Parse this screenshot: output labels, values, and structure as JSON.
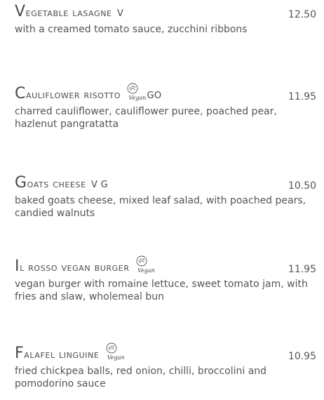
{
  "items": [
    {
      "initial": "V",
      "rest": "egetable lasagne",
      "tags": "V",
      "vegan_logo": false,
      "vegan_logo_text": "",
      "price": "12.50",
      "description": "with a creamed tomato sauce, zucchini ribbons"
    },
    {
      "initial": "C",
      "rest": "auliflower risotto",
      "tags": "Go",
      "vegan_logo": true,
      "vegan_logo_text": "Vegan",
      "price": "11.95",
      "description": "charred cauliflower, cauliflower puree, poached pear, hazlenut pangratatta"
    },
    {
      "initial": "G",
      "rest": "oats cheese",
      "tags": "V G",
      "vegan_logo": false,
      "vegan_logo_text": "",
      "price": "10.50",
      "description": "baked goats cheese, mixed leaf salad, with poached pears, candied walnuts"
    },
    {
      "initial": "I",
      "rest": "l Rosso vegan burger",
      "tags": "",
      "vegan_logo": true,
      "vegan_logo_text": "Vegan",
      "price": "11.95",
      "description": "vegan burger with romaine lettuce, sweet tomato jam, with fries and slaw, wholemeal bun"
    },
    {
      "initial": "F",
      "rest": "alafel linguine",
      "tags": "",
      "vegan_logo": true,
      "vegan_logo_text": "Vegan",
      "price": "10.95",
      "description": "fried chickpea balls, red onion, chilli, broccolini and pomodorino sauce"
    }
  ],
  "colors": {
    "text": "#4a4a4a",
    "background": "#ffffff"
  }
}
